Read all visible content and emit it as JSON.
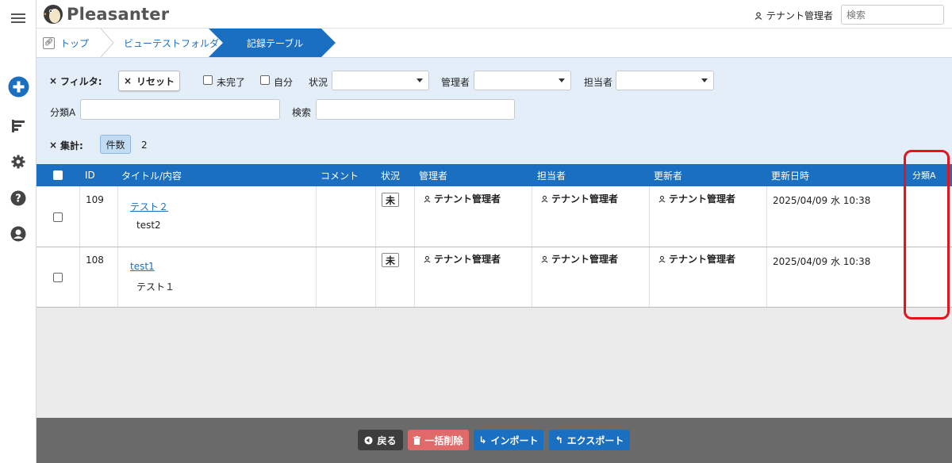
{
  "app": {
    "name": "Pleasanter"
  },
  "header": {
    "user_name": "テナント管理者",
    "search_placeholder": "検索"
  },
  "breadcrumb": [
    "トップ",
    "ビューテストフォルダ",
    "記録テーブル"
  ],
  "filters": {
    "title": "フィルタ:",
    "reset_label": "リセット",
    "incomplete_label": "未完了",
    "self_label": "自分",
    "status_label": "状況",
    "manager_label": "管理者",
    "owner_label": "担当者",
    "classa_label": "分類A",
    "search_label": "検索"
  },
  "aggregate": {
    "title": "集計:",
    "chip_label": "件数",
    "count": "2"
  },
  "table": {
    "columns": [
      "ID",
      "タイトル/内容",
      "コメント",
      "状況",
      "管理者",
      "担当者",
      "更新者",
      "更新日時",
      "分類A"
    ],
    "rows": [
      {
        "id": "109",
        "title": "テスト２",
        "body": "test2",
        "status": "未",
        "manager": "テナント管理者",
        "owner": "テナント管理者",
        "updater": "テナント管理者",
        "updated": "2025/04/09 水 10:38",
        "class_a": ""
      },
      {
        "id": "108",
        "title": "test1",
        "body": "テスト１",
        "status": "未",
        "manager": "テナント管理者",
        "owner": "テナント管理者",
        "updater": "テナント管理者",
        "updated": "2025/04/09 水 10:38",
        "class_a": ""
      }
    ]
  },
  "footer": {
    "back": "戻る",
    "bulk_delete": "一括削除",
    "import": "インポート",
    "export": "エクスポート"
  },
  "colors": {
    "accent": "#1a6fc0",
    "filter_bg": "#e3eef9",
    "footer_bg": "#6a6a6a",
    "delete": "#e06a6a",
    "highlight": "#e2141e"
  }
}
